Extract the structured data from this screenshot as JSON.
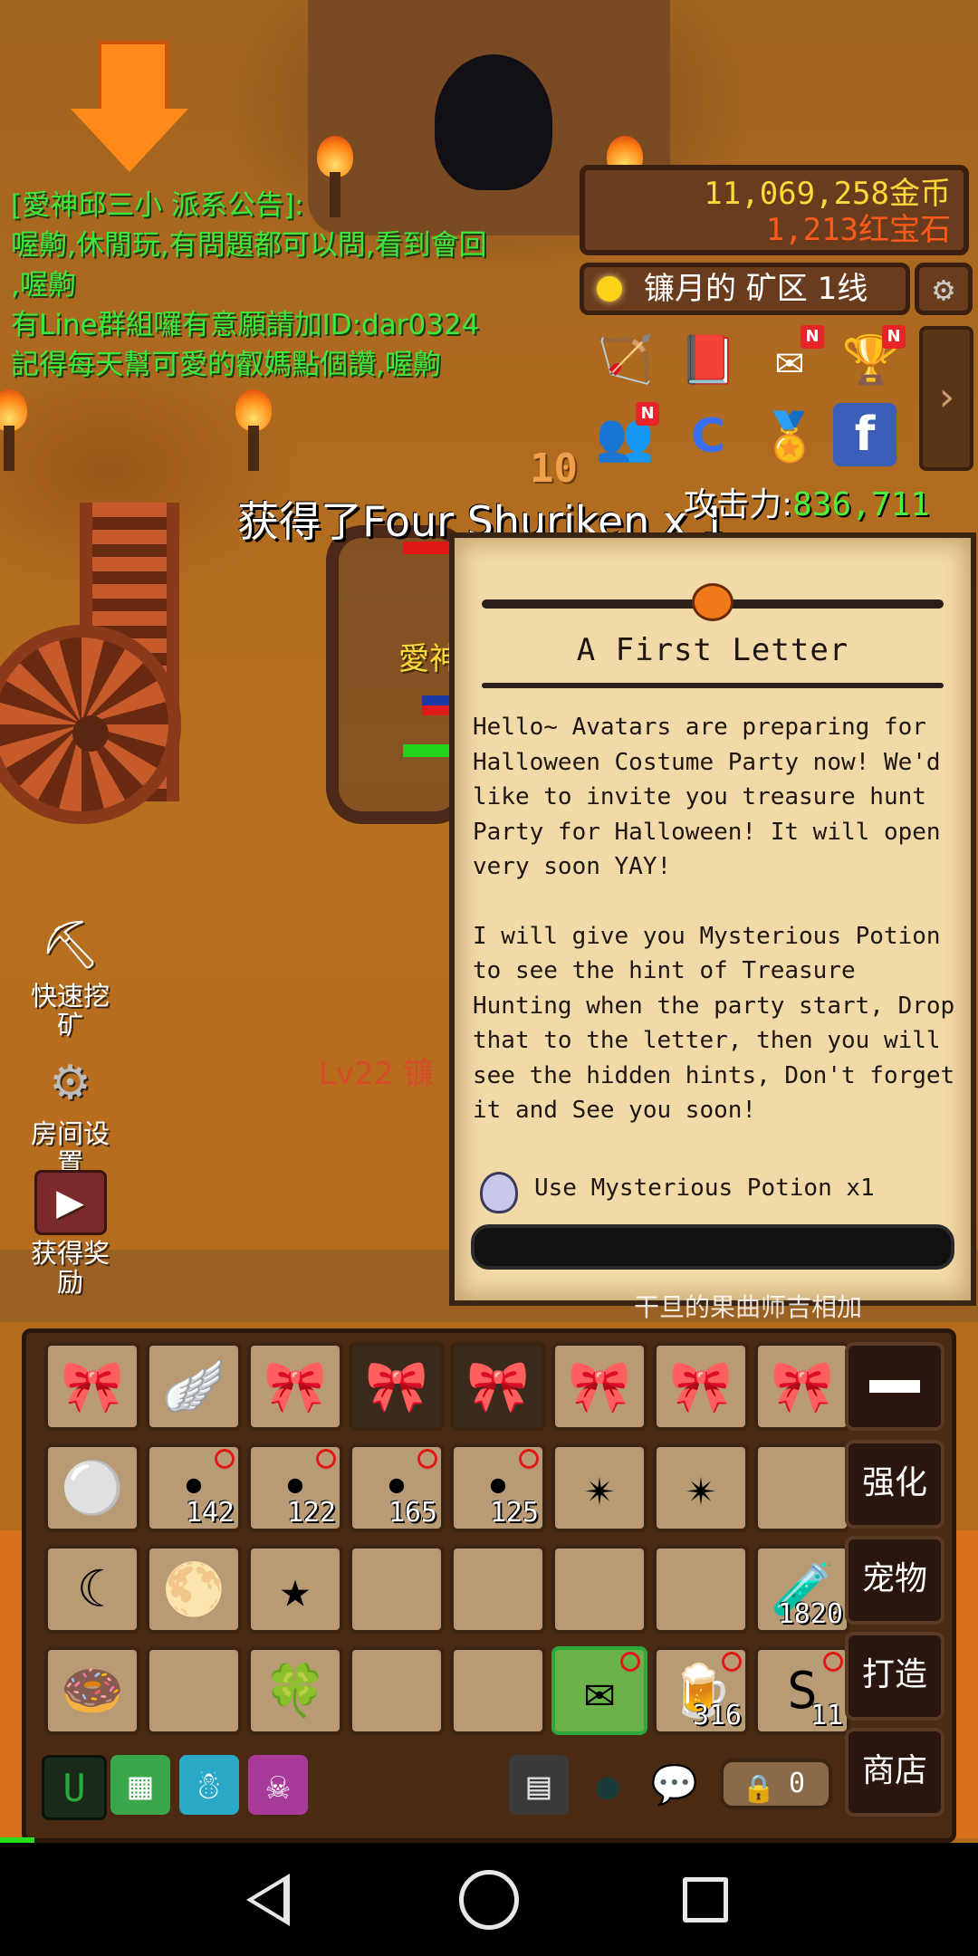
{
  "chat": {
    "lines": [
      "[愛神邱三小 派系公告]:",
      "喔齁,休閒玩,有問題都可以問,看到會回",
      ",喔齁",
      "有Line群組囉有意願請加ID:dar0324",
      "記得每天幫可愛的叡媽點個讚,喔齁"
    ]
  },
  "currency": {
    "gold": "11,069,258金币",
    "ruby": "1,213红宝石"
  },
  "location": {
    "label": "镰月的 矿区 1线"
  },
  "top_icons": [
    {
      "icon": "bow-icon",
      "glyph": "🏹",
      "badge": ""
    },
    {
      "icon": "book-icon",
      "glyph": "📕",
      "badge": ""
    },
    {
      "icon": "mail-icon",
      "glyph": "✉",
      "badge": "N"
    },
    {
      "icon": "trophy-icon",
      "glyph": "🏆",
      "badge": "N"
    },
    {
      "icon": "friends-icon",
      "glyph": "👥",
      "badge": "N"
    },
    {
      "icon": "c-shield-icon",
      "glyph": "C",
      "badge": ""
    },
    {
      "icon": "medal-icon",
      "glyph": "🏅",
      "badge": ""
    },
    {
      "icon": "facebook-icon",
      "glyph": "f",
      "badge": ""
    }
  ],
  "attack": {
    "label": "攻击力:",
    "value": "836,711"
  },
  "floating": {
    "damage": "10",
    "obtained": "获得了Four Shuriken x 1",
    "player_name": "愛神",
    "monster_name": "Lv22 镰"
  },
  "side_buttons": {
    "quick_mine": "快速挖矿",
    "room_settings": "房间设置",
    "get_reward": "获得奖励"
  },
  "letter": {
    "title": "A First Letter",
    "paragraph1": "Hello~ Avatars are preparing for Halloween Costume Party now! We'd like to invite you treasure hunt Party for Halloween! It will open very soon YAY!",
    "paragraph2": "I will give you Mysterious Potion to see the hint of Treasure Hunting when the party start, Drop that to the letter, then you will see the hidden hints, Don't forget it and See you soon!",
    "use_label": "Use Mysterious Potion x1"
  },
  "background_text": "干旦的果曲师吉相加",
  "inventory": {
    "rows": [
      [
        {
          "item": "bow-ribbon-icon",
          "glyph": "🎀",
          "count": "",
          "blocked": false,
          "state": "normal"
        },
        {
          "item": "wings-icon",
          "glyph": "🪽",
          "count": "",
          "blocked": false,
          "state": "normal"
        },
        {
          "item": "bow-ribbon-icon",
          "glyph": "🎀",
          "count": "",
          "blocked": false,
          "state": "normal"
        },
        {
          "item": "bow-ribbon-icon",
          "glyph": "🎀",
          "count": "",
          "blocked": false,
          "state": "dark"
        },
        {
          "item": "bow-ribbon-icon",
          "glyph": "🎀",
          "count": "",
          "blocked": false,
          "state": "dark"
        },
        {
          "item": "bow-ribbon-icon",
          "glyph": "🎀",
          "count": "",
          "blocked": false,
          "state": "normal"
        },
        {
          "item": "bow-ribbon-icon",
          "glyph": "🎀",
          "count": "",
          "blocked": false,
          "state": "normal"
        },
        {
          "item": "bow-ribbon-icon",
          "glyph": "🎀",
          "count": "",
          "blocked": false,
          "state": "normal"
        }
      ],
      [
        {
          "item": "snowball-icon",
          "glyph": "⚪",
          "count": "",
          "blocked": false,
          "state": "normal"
        },
        {
          "item": "ore-icon",
          "glyph": "•",
          "count": "142",
          "blocked": true,
          "state": "normal"
        },
        {
          "item": "ore-icon",
          "glyph": "•",
          "count": "122",
          "blocked": true,
          "state": "normal"
        },
        {
          "item": "ore-icon",
          "glyph": "•",
          "count": "165",
          "blocked": true,
          "state": "normal"
        },
        {
          "item": "ore-icon",
          "glyph": "•",
          "count": "125",
          "blocked": true,
          "state": "normal"
        },
        {
          "item": "shuriken-icon",
          "glyph": "✴",
          "count": "",
          "blocked": false,
          "state": "normal"
        },
        {
          "item": "shuriken-icon",
          "glyph": "✴",
          "count": "",
          "blocked": false,
          "state": "normal"
        },
        {
          "item": "empty-slot",
          "glyph": "",
          "count": "",
          "blocked": false,
          "state": "normal"
        }
      ],
      [
        {
          "item": "moon-icon",
          "glyph": "☾",
          "count": "",
          "blocked": false,
          "state": "normal"
        },
        {
          "item": "full-moon-icon",
          "glyph": "🌕",
          "count": "",
          "blocked": false,
          "state": "normal"
        },
        {
          "item": "starfish-icon",
          "glyph": "★",
          "count": "",
          "blocked": false,
          "state": "normal"
        },
        {
          "item": "empty-slot",
          "glyph": "",
          "count": "",
          "blocked": false,
          "state": "normal"
        },
        {
          "item": "empty-slot",
          "glyph": "",
          "count": "",
          "blocked": false,
          "state": "normal"
        },
        {
          "item": "empty-slot",
          "glyph": "",
          "count": "",
          "blocked": false,
          "state": "normal"
        },
        {
          "item": "empty-slot",
          "glyph": "",
          "count": "",
          "blocked": false,
          "state": "normal"
        },
        {
          "item": "potion-icon",
          "glyph": "🧪",
          "count": "1820",
          "blocked": false,
          "state": "normal"
        }
      ],
      [
        {
          "item": "donut-icon",
          "glyph": "🍩",
          "count": "",
          "blocked": false,
          "state": "normal"
        },
        {
          "item": "empty-slot",
          "glyph": "",
          "count": "",
          "blocked": false,
          "state": "normal"
        },
        {
          "item": "clover-icon",
          "glyph": "🍀",
          "count": "",
          "blocked": false,
          "state": "normal"
        },
        {
          "item": "empty-slot",
          "glyph": "",
          "count": "",
          "blocked": false,
          "state": "normal"
        },
        {
          "item": "empty-slot",
          "glyph": "",
          "count": "",
          "blocked": false,
          "state": "normal"
        },
        {
          "item": "halloween-letter-icon",
          "glyph": "✉",
          "count": "",
          "blocked": true,
          "state": "selected"
        },
        {
          "item": "beer-icon",
          "glyph": "🍺",
          "count": "316",
          "blocked": true,
          "state": "normal"
        },
        {
          "item": "worm-icon",
          "glyph": "S",
          "count": "11",
          "blocked": true,
          "state": "normal"
        }
      ]
    ],
    "tabs": {
      "collapse": "",
      "enhance": "强化",
      "pet": "宠物",
      "craft": "打造",
      "shop": "商店"
    },
    "lock_count": "0"
  }
}
